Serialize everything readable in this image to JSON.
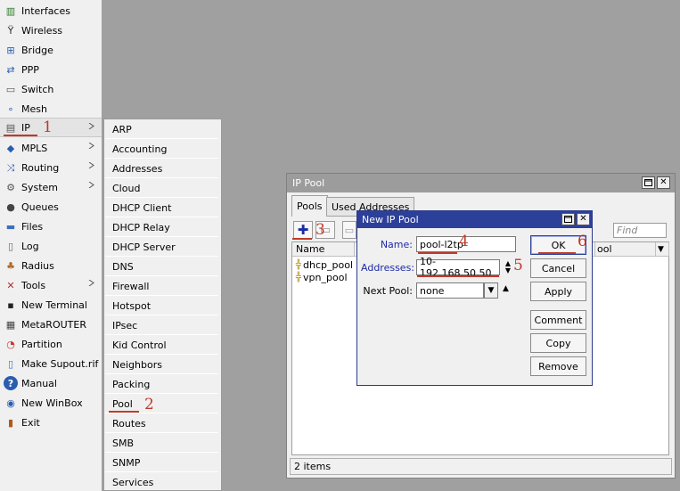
{
  "main_menu": {
    "items": [
      {
        "label": "Interfaces",
        "icon": "interfaces-icon",
        "glyph": "▥"
      },
      {
        "label": "Wireless",
        "icon": "wireless-icon",
        "glyph": "Ÿ"
      },
      {
        "label": "Bridge",
        "icon": "bridge-icon",
        "glyph": "⊞"
      },
      {
        "label": "PPP",
        "icon": "ppp-icon",
        "glyph": "⇄"
      },
      {
        "label": "Switch",
        "icon": "switch-icon",
        "glyph": "▭"
      },
      {
        "label": "Mesh",
        "icon": "mesh-icon",
        "glyph": "∘"
      },
      {
        "label": "IP",
        "icon": "ip-icon",
        "glyph": "▤"
      },
      {
        "label": "MPLS",
        "icon": "mpls-icon",
        "glyph": "◆"
      },
      {
        "label": "Routing",
        "icon": "routing-icon",
        "glyph": "⤨"
      },
      {
        "label": "System",
        "icon": "system-icon",
        "glyph": "⚙"
      },
      {
        "label": "Queues",
        "icon": "queues-icon",
        "glyph": "●"
      },
      {
        "label": "Files",
        "icon": "files-icon",
        "glyph": "▬"
      },
      {
        "label": "Log",
        "icon": "log-icon",
        "glyph": "▯"
      },
      {
        "label": "Radius",
        "icon": "radius-icon",
        "glyph": "♣"
      },
      {
        "label": "Tools",
        "icon": "tools-icon",
        "glyph": "✕"
      },
      {
        "label": "New Terminal",
        "icon": "terminal-icon",
        "glyph": "▪"
      },
      {
        "label": "MetaROUTER",
        "icon": "metarouter-icon",
        "glyph": "▦"
      },
      {
        "label": "Partition",
        "icon": "partition-icon",
        "glyph": "◔"
      },
      {
        "label": "Make Supout.rif",
        "icon": "supout-icon",
        "glyph": "▯"
      },
      {
        "label": "Manual",
        "icon": "manual-icon",
        "glyph": "?"
      },
      {
        "label": "New WinBox",
        "icon": "winbox-icon",
        "glyph": "◉"
      },
      {
        "label": "Exit",
        "icon": "exit-icon",
        "glyph": "▮"
      }
    ]
  },
  "ip_submenu": {
    "items": [
      "ARP",
      "Accounting",
      "Addresses",
      "Cloud",
      "DHCP Client",
      "DHCP Relay",
      "DHCP Server",
      "DNS",
      "Firewall",
      "Hotspot",
      "IPsec",
      "Kid Control",
      "Neighbors",
      "Packing",
      "Pool",
      "Routes",
      "SMB",
      "SNMP",
      "Services"
    ]
  },
  "annotations": {
    "n1": "1",
    "n2": "2",
    "n3": "3",
    "n4": "4",
    "n5": "5",
    "n6": "6"
  },
  "ip_pool_window": {
    "title": "IP Pool",
    "tabs": [
      "Pools",
      "Used Addresses"
    ],
    "find_placeholder": "Find",
    "columns": {
      "name": "Name",
      "next_pool_partial": "ool"
    },
    "rows": [
      "dhcp_pool",
      "vpn_pool"
    ],
    "status": "2 items"
  },
  "new_pool_dialog": {
    "title": "New IP Pool",
    "name_label": "Name:",
    "name_value": "pool-l2tp",
    "addresses_label": "Addresses:",
    "addresses_value": "10-192.168.50.50",
    "next_pool_label": "Next Pool:",
    "next_pool_value": "none",
    "buttons": {
      "ok": "OK",
      "cancel": "Cancel",
      "apply": "Apply",
      "comment": "Comment",
      "copy": "Copy",
      "remove": "Remove"
    }
  },
  "colors": {
    "accent": "#2c3f99",
    "annotation": "#c0392b",
    "label_blue": "#1c2aa6"
  }
}
